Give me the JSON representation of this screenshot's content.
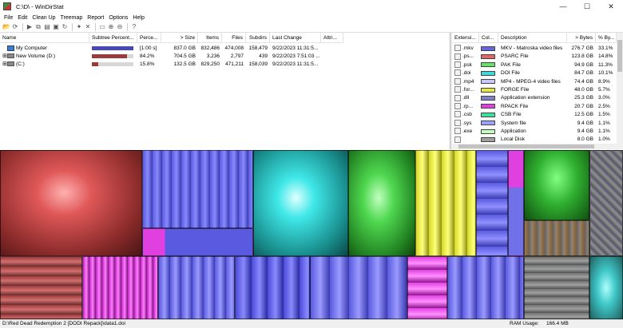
{
  "window": {
    "title": "C:\\D\\ - WinDirStat",
    "minimize": "—",
    "maximize": "☐",
    "close": "✕"
  },
  "menu": [
    "File",
    "Edit",
    "Clean Up",
    "Treemap",
    "Report",
    "Options",
    "Help"
  ],
  "toolbar_icons": [
    "open-icon",
    "refresh-icon",
    "sep",
    "play-icon",
    "copy-path-icon",
    "explorer-icon",
    "cmd-icon",
    "refresh-selected-icon",
    "sep",
    "clean-icon",
    "delete-icon",
    "sep",
    "select-parent-icon",
    "zoom-in-icon",
    "zoom-out-icon",
    "sep",
    "help-icon"
  ],
  "tree": {
    "headers": [
      "Name",
      "Subtree Percent...",
      "Perce...",
      "> Size",
      "Items",
      "Files",
      "Subdirs",
      "Last Change",
      "Attri..."
    ],
    "rows": [
      {
        "name": "My Computer",
        "percent_label": "[1:00 s]",
        "size": "837.0 GB",
        "items": "832,486",
        "files": "474,008",
        "subdirs": "158,479",
        "last_change": "9/22/2023  11:31:5...",
        "attr": "",
        "bar_fraction": 1.0,
        "bar_color": "#4848b8",
        "icon": "pc"
      },
      {
        "name": "New Volume (D:)",
        "percent_label": "84.2%",
        "size": "704.5 GB",
        "items": "3,236",
        "files": "2,797",
        "subdirs": "439",
        "last_change": "9/22/2023  7:51:03 ...",
        "attr": "",
        "bar_fraction": 0.842,
        "bar_color": "#9b3a3a",
        "icon": "drive"
      },
      {
        "name": "(C:)",
        "percent_label": "15.8%",
        "size": "132.5 GB",
        "items": "829,250",
        "files": "471,211",
        "subdirs": "158,039",
        "last_change": "9/22/2023  11:31:5...",
        "attr": "",
        "bar_fraction": 0.158,
        "bar_color": "#9b3a3a",
        "icon": "drive"
      }
    ]
  },
  "extensions": {
    "headers": [
      "Extensi...",
      "Col...",
      "Description",
      "> Bytes",
      "% By..."
    ],
    "rows": [
      {
        "ext": ".mkv",
        "color": "#6464e6",
        "desc": "MKV - Matroska video files",
        "bytes": "276.7 GB",
        "pct": "33.1%"
      },
      {
        "ext": ".ps...",
        "color": "#e66464",
        "desc": "PSARC File",
        "bytes": "123.8 GB",
        "pct": "14.8%"
      },
      {
        "ext": ".psk",
        "color": "#64e664",
        "desc": "PAK File",
        "bytes": "94.9 GB",
        "pct": "11.3%"
      },
      {
        "ext": ".doi",
        "color": "#40d8d8",
        "desc": "DOI File",
        "bytes": "84.7 GB",
        "pct": "10.1%"
      },
      {
        "ext": ".mp4",
        "color": "#c8c8ff",
        "desc": "MP4 - MPEG-4 video files",
        "bytes": "74.4 GB",
        "pct": "8.9%"
      },
      {
        "ext": ".for...",
        "color": "#e6e640",
        "desc": "FORGE File",
        "bytes": "48.0 GB",
        "pct": "5.7%"
      },
      {
        "ext": ".dll",
        "color": "#8080c8",
        "desc": "Application extension",
        "bytes": "25.3 GB",
        "pct": "3.0%"
      },
      {
        "ext": ".rp...",
        "color": "#e040e0",
        "desc": "RPACK File",
        "bytes": "20.7 GB",
        "pct": "2.5%"
      },
      {
        "ext": ".csb",
        "color": "#40e0a0",
        "desc": "CSB File",
        "bytes": "12.5 GB",
        "pct": "1.5%"
      },
      {
        "ext": ".sys",
        "color": "#a0a0ff",
        "desc": "System file",
        "bytes": "9.4 GB",
        "pct": "1.1%"
      },
      {
        "ext": ".exe",
        "color": "#c0ffc0",
        "desc": "Application",
        "bytes": "9.4 GB",
        "pct": "1.1%"
      },
      {
        "ext": "",
        "color": "#a0a0a0",
        "desc": "Local Disk",
        "bytes": "8.0 GB",
        "pct": "1.0%"
      }
    ]
  },
  "status": {
    "path": "D:\\Red Dead Redemption 2 [DODI Repack]\\data1.doi",
    "ram_label": "RAM Usage:",
    "ram_value": "166.4 MB"
  }
}
